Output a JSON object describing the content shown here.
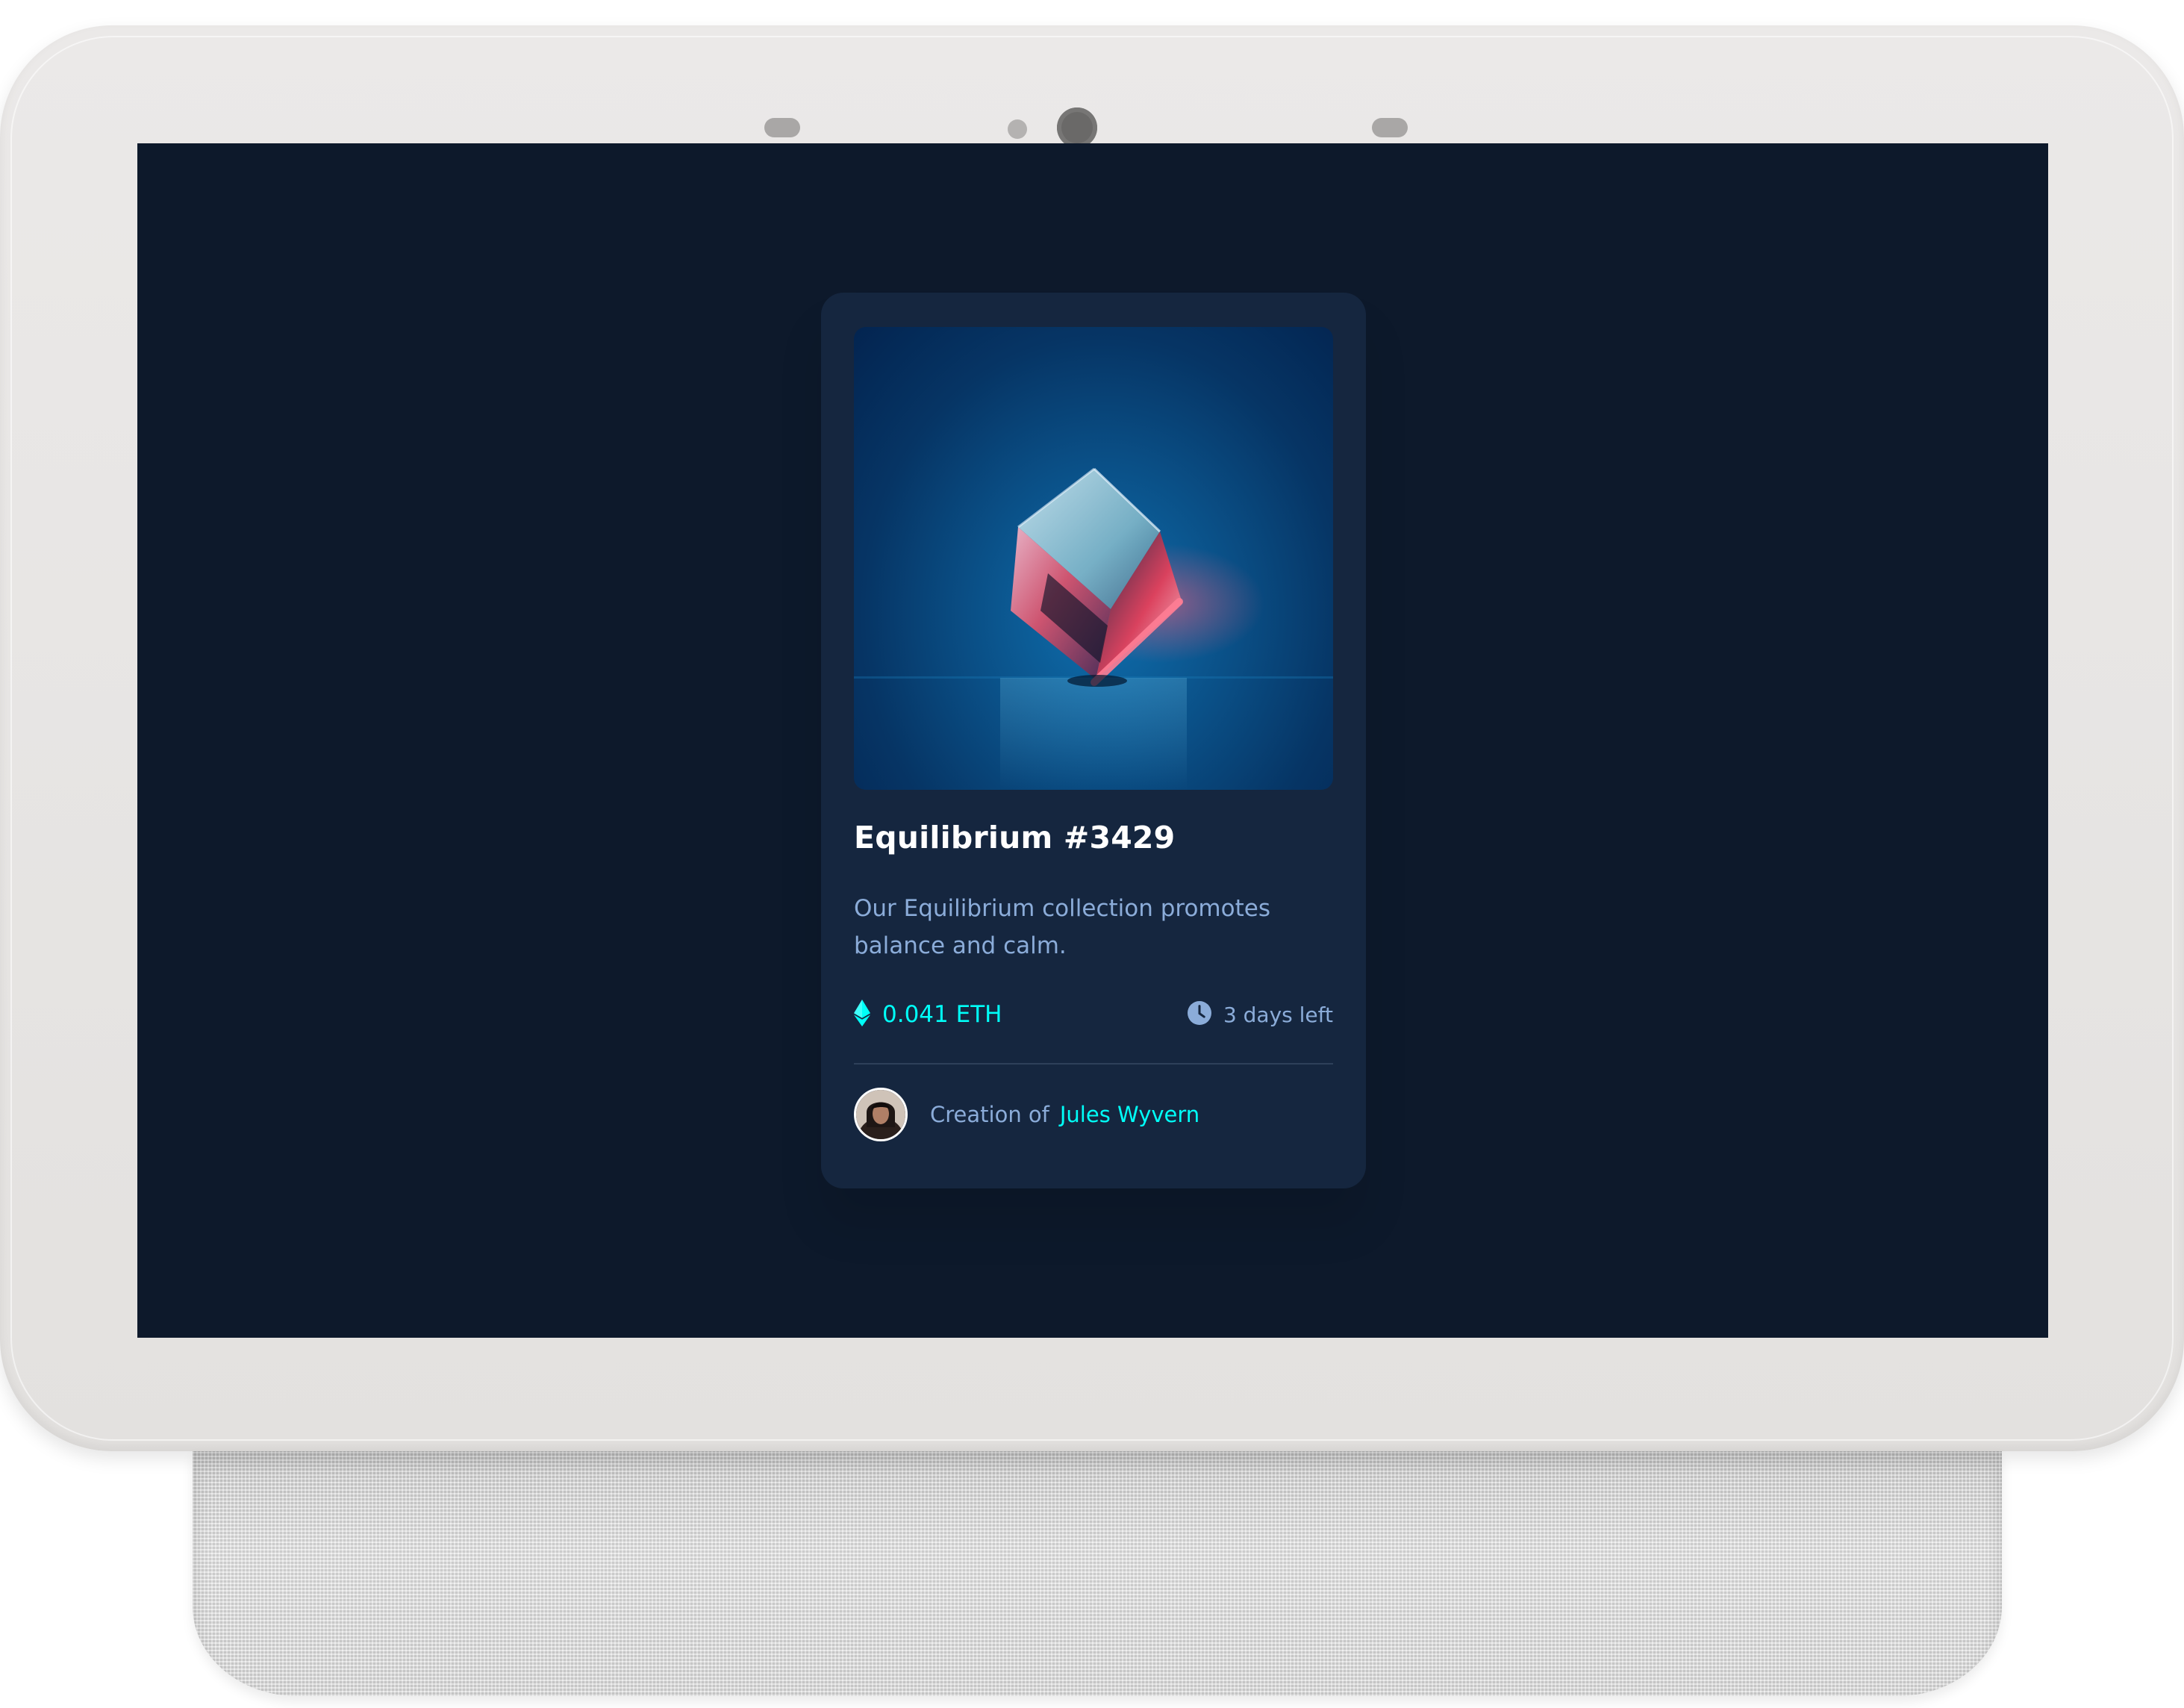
{
  "card": {
    "title": "Equilibrium #3429",
    "description": "Our Equilibrium collection promotes balance and calm.",
    "price": "0.041 ETH",
    "time_left": "3 days left",
    "creator_prefix": "Creation of",
    "creator_name": "Jules Wyvern",
    "price_icon": "ethereum-icon",
    "time_icon": "clock-icon"
  },
  "colors": {
    "screen_background": "#0d192b",
    "card_background": "#15263f",
    "accent_cyan": "#00fff8",
    "soft_blue": "#8bacd9",
    "white": "#ffffff",
    "divider": "#2e405a"
  }
}
